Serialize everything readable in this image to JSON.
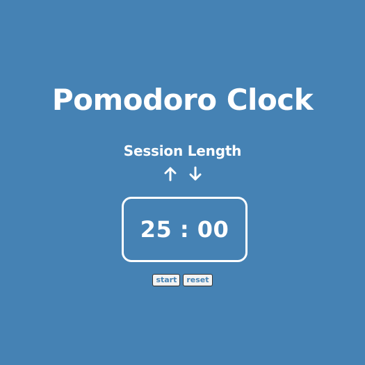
{
  "app": {
    "title": "Pomodoro Clock",
    "background_color": "#4582b4",
    "text_color": "#ffffff"
  },
  "session": {
    "label": "Session Length",
    "increase_icon": "arrow-up-icon",
    "decrease_icon": "arrow-down-icon"
  },
  "timer": {
    "display": "25 : 00",
    "minutes": "25",
    "seconds": "00"
  },
  "controls": {
    "start_label": "start",
    "reset_label": "reset"
  }
}
